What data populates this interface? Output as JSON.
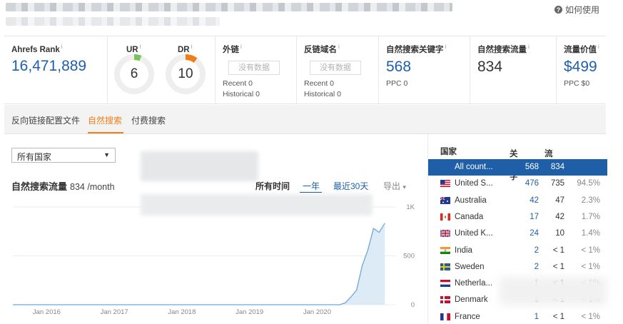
{
  "header": {
    "help_label": "如何使用",
    "help_icon": "question-circle-icon"
  },
  "metrics": {
    "ahrefs_rank": {
      "label": "Ahrefs Rank",
      "info": "i",
      "value": "16,471,889"
    },
    "ur": {
      "label": "UR",
      "info": "i",
      "value": "6",
      "ring_fraction": 0.06,
      "accent": "#7ac35a"
    },
    "dr": {
      "label": "DR",
      "info": "i",
      "value": "10",
      "ring_fraction": 0.1,
      "accent": "#f07d1a"
    },
    "backlinks": {
      "label": "外链",
      "info": "i",
      "value": "没有数据",
      "recent": "Recent 0",
      "historical": "Historical 0"
    },
    "ref_domains": {
      "label": "反链域名",
      "info": "i",
      "value": "没有数据",
      "recent": "Recent 0",
      "historical": "Historical 0"
    },
    "organic_keywords": {
      "label": "自然搜索关键字",
      "info": "i",
      "value": "568",
      "ppc": "PPC 0"
    },
    "organic_traffic": {
      "label": "自然搜索流量",
      "info": "i",
      "value": "834"
    },
    "traffic_value": {
      "label": "流量价值",
      "info": "i",
      "value": "$499",
      "ppc": "PPC $0"
    }
  },
  "tabs": [
    {
      "label": "反向链接配置文件",
      "active": false
    },
    {
      "label": "自然搜索",
      "active": true
    },
    {
      "label": "付费搜索",
      "active": false
    }
  ],
  "country_select": {
    "value": "所有国家"
  },
  "traffic": {
    "title": "自然搜索流量",
    "value": "834 /month"
  },
  "ranges": {
    "all_time": "所有时间",
    "one_year": "一年",
    "last_30": "最近30天",
    "export": "导出",
    "export_caret": "▾"
  },
  "chart_data": {
    "type": "area",
    "x_ticks": [
      "Jan 2016",
      "Jan 2017",
      "Jan 2018",
      "Jan 2019",
      "Jan 2020"
    ],
    "y_ticks": [
      "1K",
      "500",
      "0"
    ],
    "ylim": [
      0,
      1000
    ],
    "x_range": [
      "2015-07",
      "2021-03"
    ],
    "grid": true,
    "series": [
      {
        "x": [
          "2015-07",
          "2020-05",
          "2020-06",
          "2020-07",
          "2020-08",
          "2020-09",
          "2020-10",
          "2020-11",
          "2020-12",
          "2021-01"
        ],
        "values": [
          0,
          0,
          20,
          80,
          150,
          400,
          560,
          780,
          740,
          834
        ]
      }
    ]
  },
  "countries": {
    "headers": {
      "country": "国家",
      "keywords": "关键字",
      "traffic": "流量",
      "info": "i"
    },
    "rows": [
      {
        "name": "All count...",
        "keywords": "568",
        "traffic": "834",
        "share": "",
        "flag": "",
        "active": true
      },
      {
        "name": "United S...",
        "keywords": "476",
        "traffic": "735",
        "share": "94.5%",
        "flag": "us"
      },
      {
        "name": "Australia",
        "keywords": "42",
        "traffic": "47",
        "share": "2.3%",
        "flag": "au"
      },
      {
        "name": "Canada",
        "keywords": "17",
        "traffic": "42",
        "share": "1.7%",
        "flag": "ca"
      },
      {
        "name": "United K...",
        "keywords": "24",
        "traffic": "10",
        "share": "1.4%",
        "flag": "gb"
      },
      {
        "name": "India",
        "keywords": "2",
        "traffic": "< 1",
        "share": "< 1%",
        "flag": "in"
      },
      {
        "name": "Sweden",
        "keywords": "2",
        "traffic": "< 1",
        "share": "< 1%",
        "flag": "se"
      },
      {
        "name": "Netherla...",
        "keywords": "1",
        "traffic": "< 1",
        "share": "< 1%",
        "flag": "nl"
      },
      {
        "name": "Denmark",
        "keywords": "1",
        "traffic": "< 1",
        "share": "< 1%",
        "flag": "dk"
      },
      {
        "name": "France",
        "keywords": "1",
        "traffic": "< 1",
        "share": "< 1%",
        "flag": "fr"
      }
    ]
  }
}
